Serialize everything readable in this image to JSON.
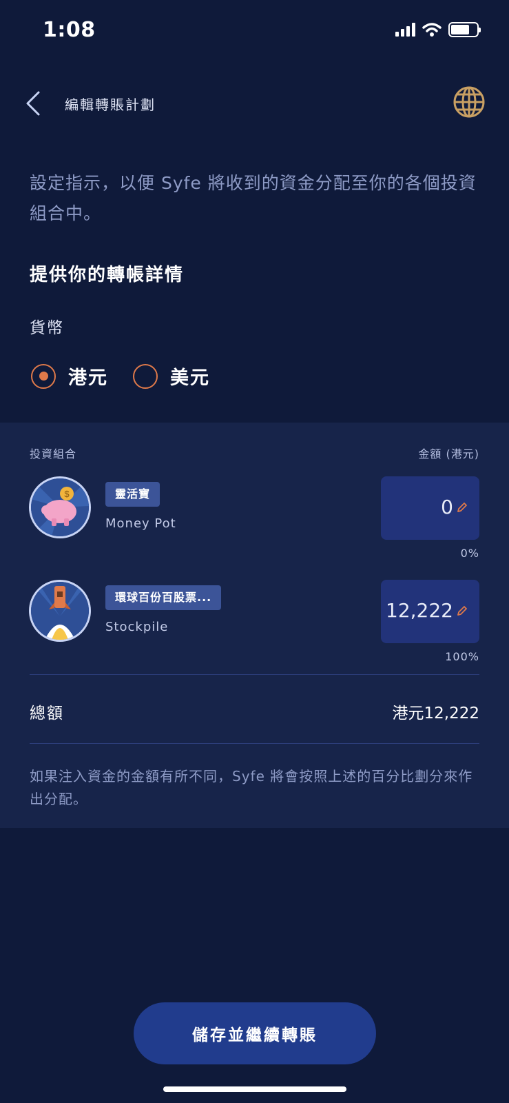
{
  "status_bar": {
    "time": "1:08"
  },
  "nav": {
    "title": "編輯轉賬計劃"
  },
  "intro_text": "設定指示，以便 Syfe 將收到的資金分配至你的各個投資組合中。",
  "section_title": "提供你的轉帳詳情",
  "currency": {
    "label": "貨幣",
    "options": [
      {
        "label": "港元",
        "selected": true
      },
      {
        "label": "美元",
        "selected": false
      }
    ]
  },
  "portfolio_table": {
    "header_left": "投資組合",
    "header_right": "金額 (港元)",
    "rows": [
      {
        "tag": "靈活寶",
        "name": "Money Pot",
        "amount": "0",
        "percent": "0%",
        "icon": "piggy-bank-icon"
      },
      {
        "tag": "環球百份百股票...",
        "name": "Stockpile",
        "amount": "12,222",
        "percent": "100%",
        "icon": "rocket-icon"
      }
    ]
  },
  "total": {
    "label": "總額",
    "value": "港元12,222"
  },
  "note": "如果注入資金的金額有所不同，Syfe 將會按照上述的百分比劃分來作出分配。",
  "primary_button": "儲存並繼續轉賬",
  "colors": {
    "background": "#0f1a3a",
    "panel": "#17244a",
    "accent": "#e07a4a",
    "button": "#213c8d"
  }
}
